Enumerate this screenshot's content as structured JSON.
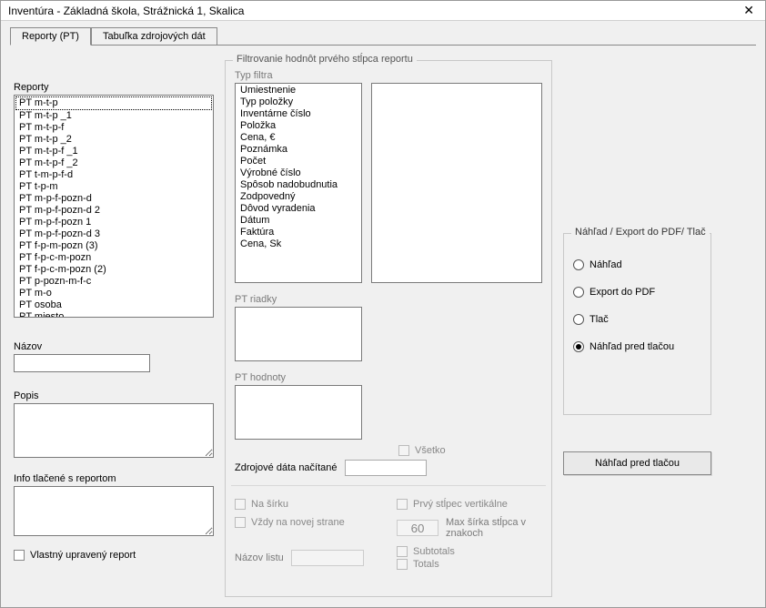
{
  "window": {
    "title": "Inventúra - Základná škola, Strážnická 1, Skalica"
  },
  "tabs": {
    "reporty": "Reporty (PT)",
    "zdroj": "Tabuľka zdrojových dát"
  },
  "left": {
    "reporty_label": "Reporty",
    "reporty_items": [
      "PT m-t-p",
      "PT m-t-p _1",
      "PT m-t-p-f",
      "PT m-t-p _2",
      "PT m-t-p-f _1",
      "PT m-t-p-f _2",
      "PT t-m-p-f-d",
      "PT t-p-m",
      "PT m-p-f-pozn-d",
      "PT m-p-f-pozn-d 2",
      "PT m-p-f-pozn 1",
      "PT m-p-f-pozn-d 3",
      "PT f-p-m-pozn (3)",
      "PT f-p-c-m-pozn",
      "PT f-p-c-m-pozn (2)",
      "PT p-pozn-m-f-c",
      "PT m-o",
      "PT osoba",
      "PT miesto"
    ],
    "reporty_selected_index": 0,
    "nazov_label": "Názov",
    "popis_label": "Popis",
    "info_label": "Info tlačené s reportom",
    "vlastny_label": "Vlastný upravený report"
  },
  "mid": {
    "group_title": "Filtrovanie hodnôt prvého stĺpca reportu",
    "typ_filtra_label": "Typ filtra",
    "typ_filtra_items": [
      "Umiestnenie",
      "Typ položky",
      "Inventárne číslo",
      "Položka",
      "Cena, €",
      "Poznámka",
      "Počet",
      "Výrobné číslo",
      "Spôsob nadobudnutia",
      "Zodpovedný",
      "Dôvod vyradenia",
      "Dátum",
      "Faktúra",
      "Cena, Sk"
    ],
    "pt_riadky_label": "PT riadky",
    "pt_hodnoty_label": "PT hodnoty",
    "vsetko_label": "Všetko",
    "zdrojove_label": "Zdrojové dáta načítané",
    "na_sirku_label": "Na šírku",
    "vzdy_novej_label": "Vždy na novej strane",
    "prvy_stlpec_label": "Prvý stĺpec vertikálne",
    "max_sirka_label": "Max šírka stĺpca v znakoch",
    "max_sirka_value": "60",
    "subtotals_label": "Subtotals",
    "totals_label": "Totals",
    "nazov_listu_label": "Názov listu"
  },
  "right": {
    "group_title": "Náhľad / Export do PDF/ Tlač",
    "options": [
      "Náhľad",
      "Export do PDF",
      "Tlač",
      "Náhľad pred tlačou"
    ],
    "selected_index": 3,
    "button_label": "Náhľad pred tlačou"
  }
}
